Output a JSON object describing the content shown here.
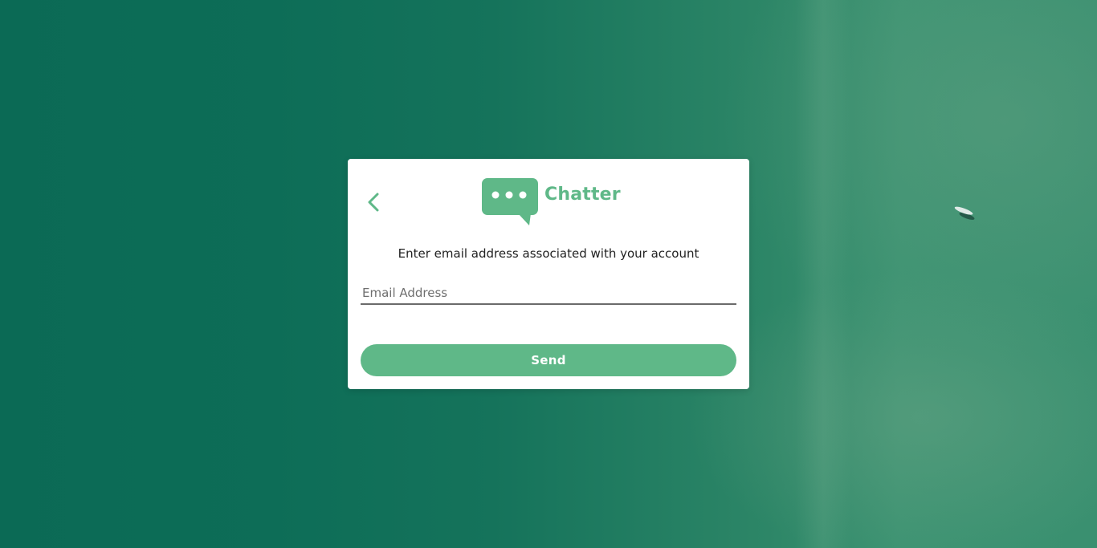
{
  "app": {
    "brand_name": "Chatter",
    "accent_color": "#5fb888"
  },
  "icons": {
    "back": "chevron-left-icon",
    "logo": "chat-bubble-icon"
  },
  "form": {
    "instruction": "Enter email address associated with your account",
    "email_placeholder": "Email Address",
    "email_value": "",
    "send_label": "Send"
  }
}
